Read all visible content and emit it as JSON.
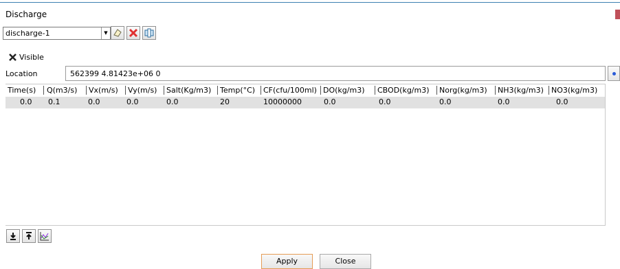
{
  "dialog": {
    "title": "Discharge"
  },
  "discharge_select": {
    "value": "discharge-1"
  },
  "visible_checkbox": {
    "label": "Visible",
    "checked": true
  },
  "location": {
    "label": "Location",
    "value": "562399 4.81423e+06 0"
  },
  "table": {
    "columns": [
      "Time(s)",
      "Q(m3/s)",
      "Vx(m/s)",
      "Vy(m/s)",
      "Salt(Kg/m3)",
      "Temp(°C)",
      "CF(cfu/100ml)",
      "DO(kg/m3)",
      "CBOD(kg/m3)",
      "Norg(kg/m3)",
      "NH3(kg/m3)",
      "NO3(kg/m3)"
    ],
    "rows": [
      [
        "0.0",
        "0.1",
        "0.0",
        "0.0",
        "0.0",
        "20",
        "10000000",
        "0.0",
        "0.0",
        "0.0",
        "0.0",
        "0.0"
      ]
    ]
  },
  "buttons": {
    "apply": "Apply",
    "close": "Close"
  },
  "colors": {
    "accent_line": "#3c7fb1",
    "title_marker": "#c0505a",
    "delete_icon": "#e03030",
    "apply_border": "#e59b54"
  },
  "icons": [
    "edit-icon",
    "delete-icon",
    "copy-icon",
    "move-down-icon",
    "move-up-icon",
    "chart-icon",
    "pick-location-icon",
    "chevron-down-icon"
  ]
}
